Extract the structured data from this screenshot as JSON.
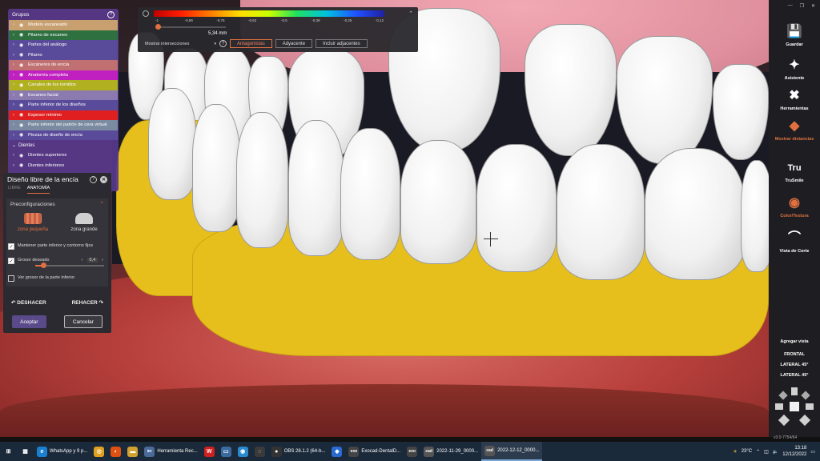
{
  "groups_panel": {
    "title": "Grupos",
    "help": "?",
    "items": [
      {
        "label": "Modelo escaneado",
        "color": "#c8a070"
      },
      {
        "label": "Pilares de escaneo",
        "color": "#2e7040"
      },
      {
        "label": "Partes del análogo",
        "color": "#5a4a9a"
      },
      {
        "label": "Pilares",
        "color": "#5a4a9a"
      },
      {
        "label": "Escáneres de encía",
        "color": "#c07070"
      },
      {
        "label": "Anatomía completa",
        "color": "#c020c0"
      },
      {
        "label": "Canales de los tornillos",
        "color": "#b0b020"
      },
      {
        "label": "Escaneo facial",
        "color": "#8a7ab0"
      },
      {
        "label": "Parte inferior de los diseños",
        "color": "#5a4a9a"
      },
      {
        "label": "Espesor mínimo",
        "color": "#e02020"
      },
      {
        "label": "Parte inferior del patrón de cera virtual",
        "color": "#7a8aa0"
      },
      {
        "label": "Piezas de diseño de encía",
        "color": "#5a4a9a"
      }
    ],
    "teeth_header": "Dientes",
    "teeth_items": [
      "Dientes superiores",
      "Dientes inferiores"
    ]
  },
  "gum_panel": {
    "title": "Diseño libre de la encía",
    "help": "?",
    "close": "✕",
    "tabs": [
      "LIBRE",
      "ANATOMÍA"
    ],
    "active_tab": "ANATOMÍA",
    "presets_title": "Preconfiguraciones",
    "preset_small": "zona pequeña",
    "preset_large": "zona grande",
    "opt_keep": "Mantener parte inferior y contorno fijos",
    "opt_thickness": "Grosor deseado",
    "thickness_value": "0,4",
    "thickness_fraction": 0.12,
    "opt_show_bottom": "Ver grosor de la parte inferior",
    "undo": "DESHACER",
    "redo": "REHACER",
    "accept": "Aceptar",
    "cancel": "Cancelar"
  },
  "distance_panel": {
    "ticks": [
      "-1",
      "-0,86",
      "-0,75",
      "-0,62",
      "-0,5",
      "-0,38",
      "-0,25",
      "-0,12"
    ],
    "value": "5,34 mm",
    "dropdown": "Mostrar intersecciones",
    "help": "?",
    "buttons": [
      "Antagonistas",
      "Adyacente",
      "Incluir adjacentes"
    ],
    "active_button": "Antagonistas"
  },
  "right_toolbar": {
    "tools": [
      {
        "label": "Guardar",
        "icon": "💾"
      },
      {
        "label": "Asistente",
        "icon": "✦"
      },
      {
        "label": "Herramientas",
        "icon": "✖"
      },
      {
        "label": "Mostrar distancias",
        "icon": "◆"
      },
      {
        "label": "TruSmile",
        "icon": "Tru"
      },
      {
        "label": "Color/Textura",
        "icon": "◉"
      },
      {
        "label": "Vista de Corte",
        "icon": "⌒"
      }
    ],
    "views_title": "Agregar vista",
    "views": [
      "FRONTAL",
      "LATERAL 45°",
      "LATERAL 45°"
    ],
    "version": "v3.0-7754/64"
  },
  "taskbar": {
    "items": [
      {
        "label": "",
        "icon": "⊞",
        "color": "#1b2a3a"
      },
      {
        "label": "",
        "icon": "▦",
        "color": "#1b2a3a"
      },
      {
        "label": "WhatsApp y 9 p...",
        "icon": "e",
        "color": "#1a7fd0"
      },
      {
        "label": "",
        "icon": "◎",
        "color": "#e0a020"
      },
      {
        "label": "",
        "icon": "◐",
        "color": "#e05010"
      },
      {
        "label": "",
        "icon": "▬",
        "color": "#d0a030"
      },
      {
        "label": "Herramienta Rec...",
        "icon": "✂",
        "color": "#4a6a9a"
      },
      {
        "label": "",
        "icon": "W",
        "color": "#d02020"
      },
      {
        "label": "",
        "icon": "▭",
        "color": "#3a6aa0"
      },
      {
        "label": "",
        "icon": "◉",
        "color": "#2a8ad0"
      },
      {
        "label": "",
        "icon": "◌",
        "color": "#3a3a3a"
      },
      {
        "label": "OBS 28.1.2 (64-b...",
        "icon": "●",
        "color": "#333"
      },
      {
        "label": "",
        "icon": "◆",
        "color": "#2a6ad0"
      },
      {
        "label": "Exocad-DentalD...",
        "icon": "exo",
        "color": "#444"
      },
      {
        "label": "",
        "icon": "exo",
        "color": "#444"
      },
      {
        "label": "2022-11-29_0000...",
        "icon": "cad",
        "color": "#555"
      },
      {
        "label": "2022-12-12_0000...",
        "icon": "cad",
        "color": "#555"
      }
    ],
    "active_index": 16,
    "weather": "23°C",
    "time": "13:18",
    "date": "12/12/2022"
  }
}
